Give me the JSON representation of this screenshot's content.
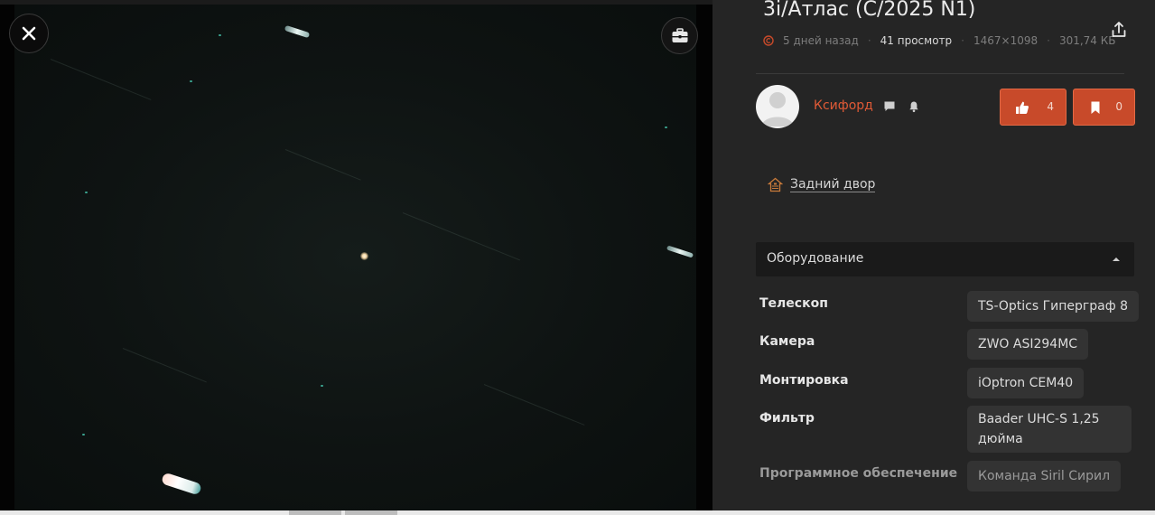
{
  "image": {
    "title": "3i/Атлас (C/2025 N1)",
    "posted_ago": "5 дней назад",
    "views": "41 просмотр",
    "dimensions": "1467×1098",
    "file_size": "301,74 КБ"
  },
  "author": {
    "name": "Ксифорд"
  },
  "actions": {
    "likes": "4",
    "bookmarks": "0"
  },
  "location": {
    "name": "Задний двор"
  },
  "equipment": {
    "header": "Оборудование",
    "rows": [
      {
        "label": "Телескоп",
        "value": "TS-Optics Гиперграф 8"
      },
      {
        "label": "Камера",
        "value": "ZWO ASI294MC"
      },
      {
        "label": "Монтировка",
        "value": "iOptron CEM40"
      },
      {
        "label": "Фильтр",
        "value": "Baader UHC-S 1,25 дюйма"
      },
      {
        "label": "Программное обеспечение",
        "value": "Команда Siril Сирил"
      }
    ]
  },
  "colors": {
    "accent": "#c84a2a",
    "panel_bg": "#252525",
    "username": "#e05a36"
  },
  "icons": {
    "close": "close-icon",
    "tools": "toolbox-icon",
    "share": "share-icon",
    "copyright": "copyright-icon",
    "message": "message-icon",
    "bell": "bell-icon",
    "like": "thumbs-up-icon",
    "bookmark": "bookmark-icon",
    "location": "house-icon"
  }
}
